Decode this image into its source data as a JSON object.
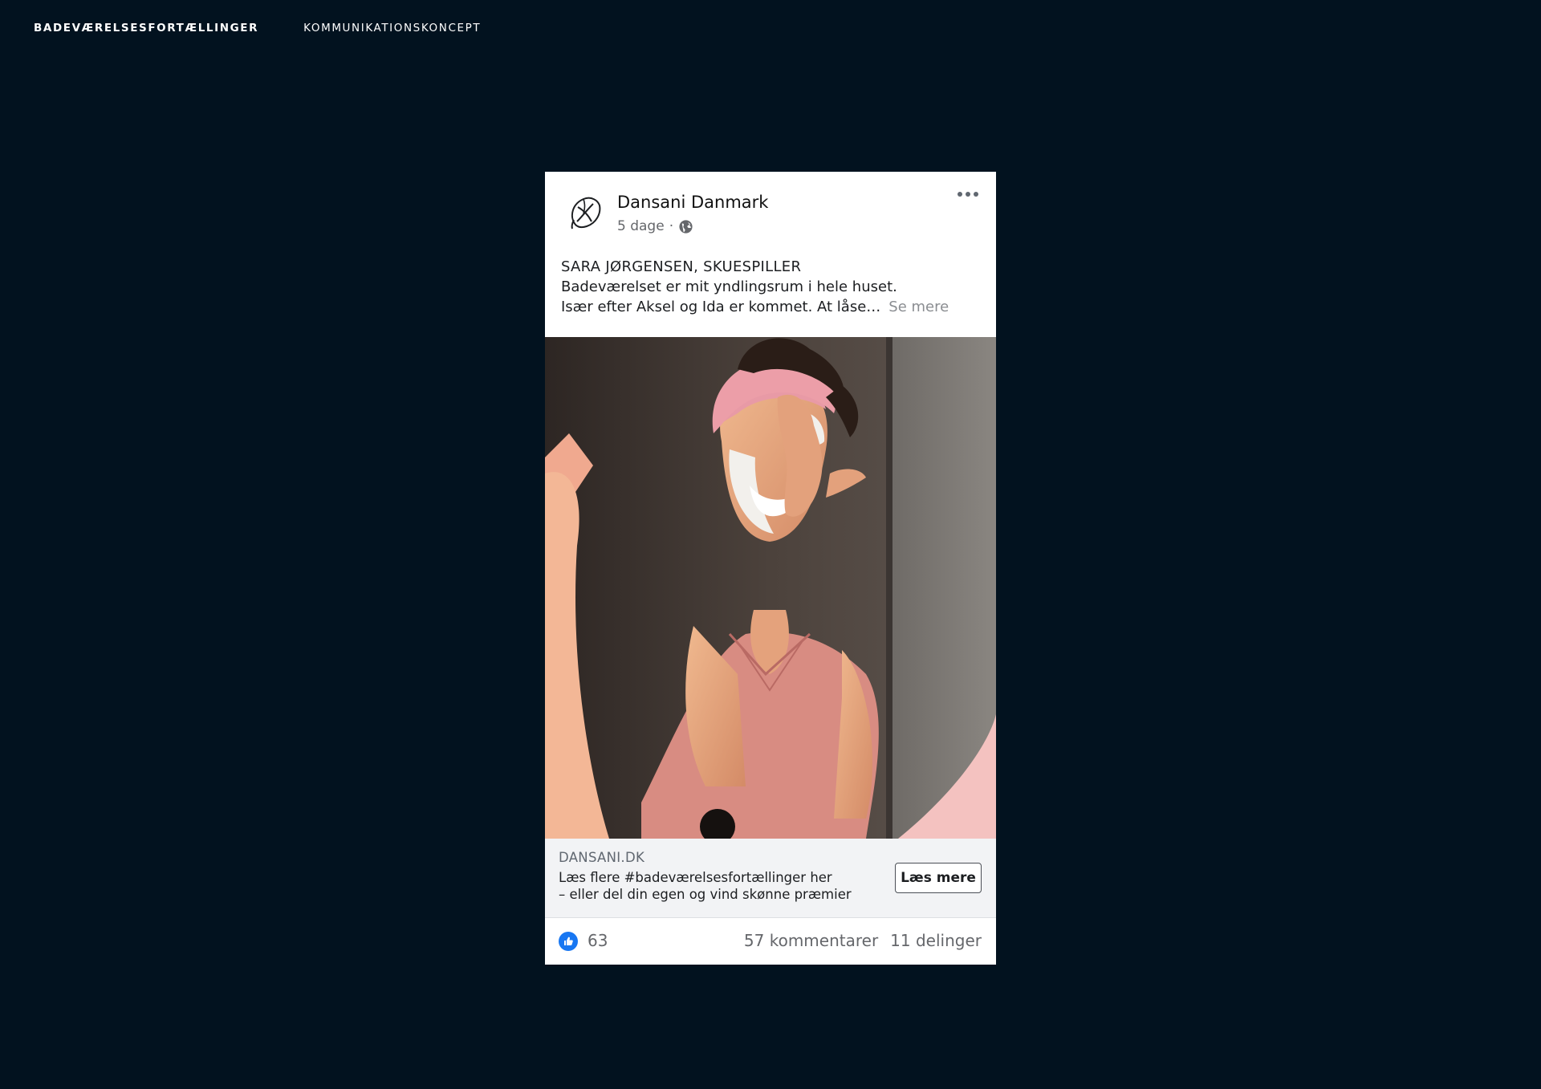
{
  "nav": {
    "items": [
      {
        "label": "BADEVÆRELSESFORTÆLLINGER",
        "active": true
      },
      {
        "label": "KOMMUNIKATIONSKONCEPT",
        "active": false
      }
    ]
  },
  "post": {
    "page_name": "Dansani Danmark",
    "time": "5 dage",
    "separator": "·",
    "audience_icon": "globe-icon",
    "more_icon": "more-dots-icon",
    "heading": "SARA JØRGENSEN, SKUESPILLER",
    "text_line1": "Badeværelset er mit yndlingsrum i hele huset.",
    "text_line2": "Især efter Aksel og Ida er kommet. At låse…",
    "see_more": "Se mere",
    "link": {
      "domain": "DANSANI.DK",
      "title_line1": "Læs flere #badeværelsesfortællinger her",
      "title_line2": "– eller del din egen og vind skønne præmier",
      "cta": "Læs mere"
    },
    "reactions": {
      "icon": "like-icon",
      "count": "63",
      "comments": "57 kommentarer",
      "shares": "11 delinger"
    }
  },
  "colors": {
    "background": "#02121f",
    "card": "#ffffff",
    "like_blue": "#1877f2",
    "muted_text": "#65676b"
  }
}
